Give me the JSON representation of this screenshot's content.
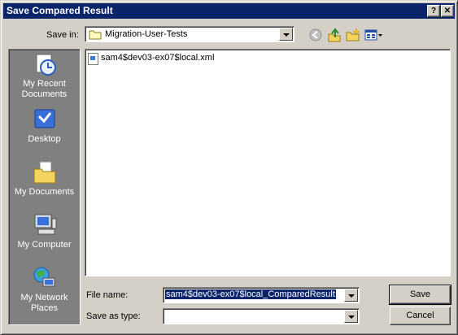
{
  "window": {
    "title": "Save Compared Result",
    "help_glyph": "?",
    "close_glyph": "✕"
  },
  "toolbar": {
    "save_in_label": "Save in:",
    "save_in_value": "Migration-User-Tests"
  },
  "places": [
    {
      "label": "My Recent Documents",
      "icon": "recent-documents-icon"
    },
    {
      "label": "Desktop",
      "icon": "desktop-icon"
    },
    {
      "label": "My Documents",
      "icon": "my-documents-icon"
    },
    {
      "label": "My Computer",
      "icon": "my-computer-icon"
    },
    {
      "label": "My Network Places",
      "icon": "network-places-icon"
    }
  ],
  "files": [
    {
      "name": "sam4$dev03-ex07$local.xml",
      "icon": "xml-file-icon"
    }
  ],
  "form": {
    "file_name_label": "File name:",
    "file_name_value": "sam4$dev03-ex07$local_ComparedResult",
    "save_as_type_label": "Save as type:",
    "save_as_type_value": ""
  },
  "buttons": {
    "save": "Save",
    "cancel": "Cancel"
  },
  "colors": {
    "titlebar": "#0a246a",
    "places_bg": "#808080",
    "face": "#d4d0c8"
  }
}
